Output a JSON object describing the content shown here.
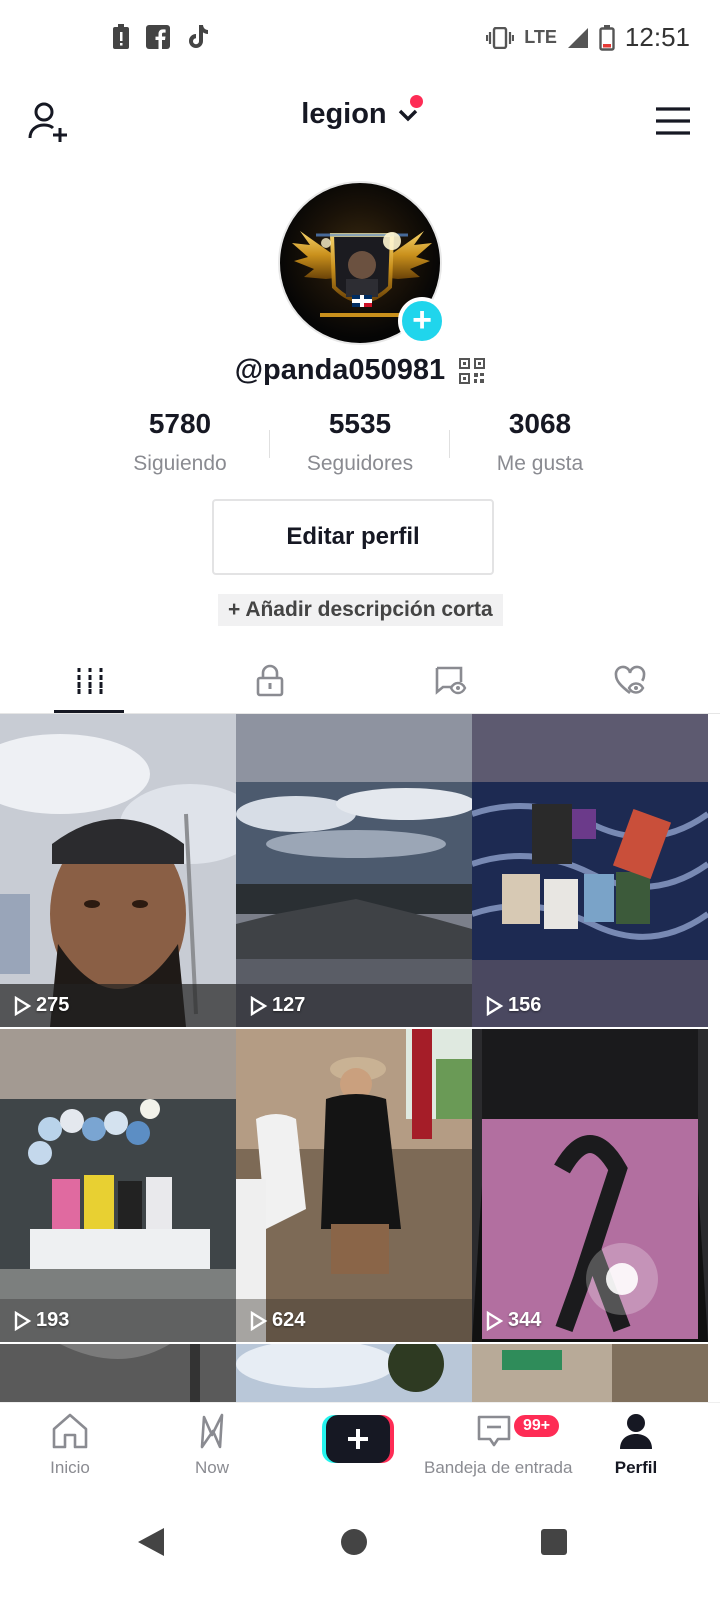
{
  "status_bar": {
    "time": "12:51",
    "network": "LTE",
    "icons": [
      "alert-battery-icon",
      "facebook-icon",
      "tiktok-icon",
      "vibrate-icon",
      "signal-icon",
      "battery-icon"
    ]
  },
  "header": {
    "account_name": "legion",
    "icons": [
      "add-user-icon",
      "chevron-down-icon",
      "menu-icon"
    ]
  },
  "profile": {
    "username": "@panda050981",
    "stats": [
      {
        "value": "5780",
        "label": "Siguiendo"
      },
      {
        "value": "5535",
        "label": "Seguidores"
      },
      {
        "value": "3068",
        "label": "Me gusta"
      }
    ],
    "edit_button": "Editar perfil",
    "description_chip": "+ Añadir descripción corta"
  },
  "tabs": [
    "videos-grid-icon",
    "lock-icon",
    "tagged-icon",
    "liked-icon"
  ],
  "videos": [
    {
      "views": "275"
    },
    {
      "views": "127"
    },
    {
      "views": "156"
    },
    {
      "views": "193"
    },
    {
      "views": "624"
    },
    {
      "views": "344"
    }
  ],
  "bottom_nav": {
    "items": [
      {
        "label": "Inicio",
        "icon": "home-icon"
      },
      {
        "label": "Now",
        "icon": "now-icon"
      },
      {
        "label": "",
        "icon": "create-icon"
      },
      {
        "label": "Bandeja de entrada",
        "icon": "inbox-icon",
        "badge": "99+"
      },
      {
        "label": "Perfil",
        "icon": "profile-icon"
      }
    ]
  },
  "colors": {
    "accent_red": "#fe2c55",
    "accent_cyan": "#20d5ec",
    "text_primary": "#161823",
    "text_secondary": "#8a8b91"
  }
}
